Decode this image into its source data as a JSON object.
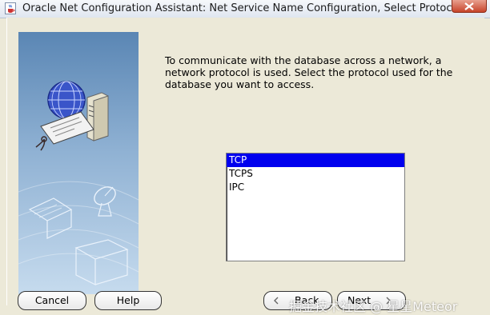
{
  "window": {
    "title": "Oracle Net Configuration Assistant: Net Service Name Configuration, Select Protocols"
  },
  "instruction": "To communicate with the database across a network, a network protocol is used. Select the protocol used for the database you want to access.",
  "protocols": {
    "items": [
      "TCP",
      "TCPS",
      "IPC"
    ],
    "selected": "TCP"
  },
  "buttons": {
    "cancel": "Cancel",
    "help": "Help",
    "back": "Back",
    "next": "Next"
  },
  "watermark": "掘金技术社区 @ 星星Meteor",
  "icons": {
    "app": "java-cup-icon",
    "close": "close-icon",
    "back": "chevron-left-icon",
    "next": "chevron-right-icon"
  },
  "colors": {
    "selection": "#0000ee",
    "window_bg": "#ece9d8"
  }
}
